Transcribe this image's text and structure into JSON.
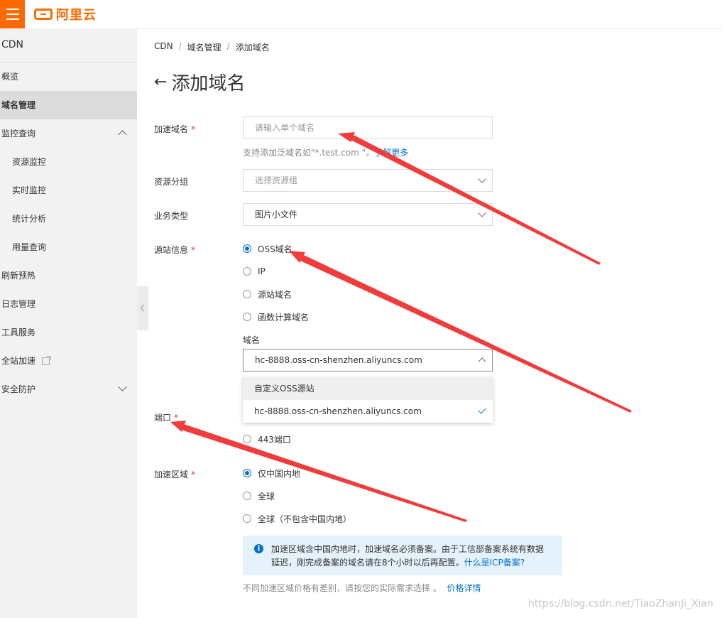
{
  "topbar": {
    "brand": "阿里云",
    "menu_icon": "hamburger-menu-icon"
  },
  "sidebar": {
    "title": "CDN",
    "items": [
      {
        "label": "概览"
      },
      {
        "label": "域名管理"
      },
      {
        "label": "监控查询"
      },
      {
        "label": "资源监控"
      },
      {
        "label": "实时监控"
      },
      {
        "label": "统计分析"
      },
      {
        "label": "用量查询"
      },
      {
        "label": "刷新预热"
      },
      {
        "label": "日志管理"
      },
      {
        "label": "工具服务"
      },
      {
        "label": "全站加速"
      },
      {
        "label": "安全防护"
      }
    ]
  },
  "breadcrumb": {
    "items": [
      "CDN",
      "域名管理",
      "添加域名"
    ],
    "separator": "/"
  },
  "page": {
    "title": "添加域名"
  },
  "form": {
    "domain": {
      "label": "加速域名",
      "placeholder": "请输入单个域名",
      "help_prefix": "支持添加泛域名如\"*.test.com \"。",
      "help_link": "了解更多"
    },
    "resource_group": {
      "label": "资源分组",
      "placeholder": "选择资源组"
    },
    "business_type": {
      "label": "业务类型",
      "value": "图片小文件"
    },
    "origin": {
      "label": "源站信息",
      "options": [
        "OSS域名",
        "IP",
        "源站域名",
        "函数计算域名"
      ],
      "selected": "OSS域名",
      "domain_label": "域名",
      "domain_value": "hc-8888.oss-cn-shenzhen.aliyuncs.com",
      "dropdown_options": [
        "自定义OSS源站",
        "hc-8888.oss-cn-shenzhen.aliyuncs.com"
      ]
    },
    "port": {
      "label": "端口",
      "option_443": "443端口"
    },
    "region": {
      "label": "加速区域",
      "options": [
        "仅中国内地",
        "全球",
        "全球（不包含中国内地）"
      ],
      "selected": "仅中国内地",
      "notice": "加速区域含中国内地时，加速域名必须备案。由于工信部备案系统有数据延迟，刚完成备案的域名请在8个小时以后再配置。",
      "notice_link": "什么是ICP备案?",
      "price_note": "不同加速区域价格有差别，请按您的实际需求选择 。",
      "price_link": "价格详情"
    },
    "required_mark": "*"
  },
  "watermark": "https://blog.csdn.net/TiaoZhanJi_Xian",
  "colors": {
    "brand": "#ff6a00",
    "link": "#0070cc",
    "required": "#e4393c",
    "annotation_arrow": "#f03c3c"
  }
}
